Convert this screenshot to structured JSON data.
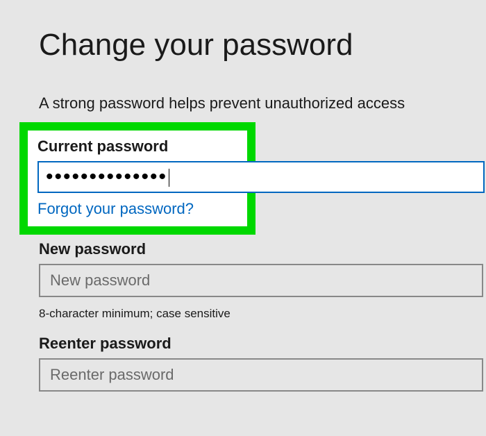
{
  "page": {
    "title": "Change your password",
    "subtitle": "A strong password helps prevent unauthorized access"
  },
  "current_password": {
    "label": "Current password",
    "value": "••••••••••••••",
    "forgot_link": "Forgot your password?"
  },
  "new_password": {
    "label": "New password",
    "placeholder": "New password",
    "hint": "8-character minimum; case sensitive"
  },
  "reenter_password": {
    "label": "Reenter password",
    "placeholder": "Reenter password"
  }
}
